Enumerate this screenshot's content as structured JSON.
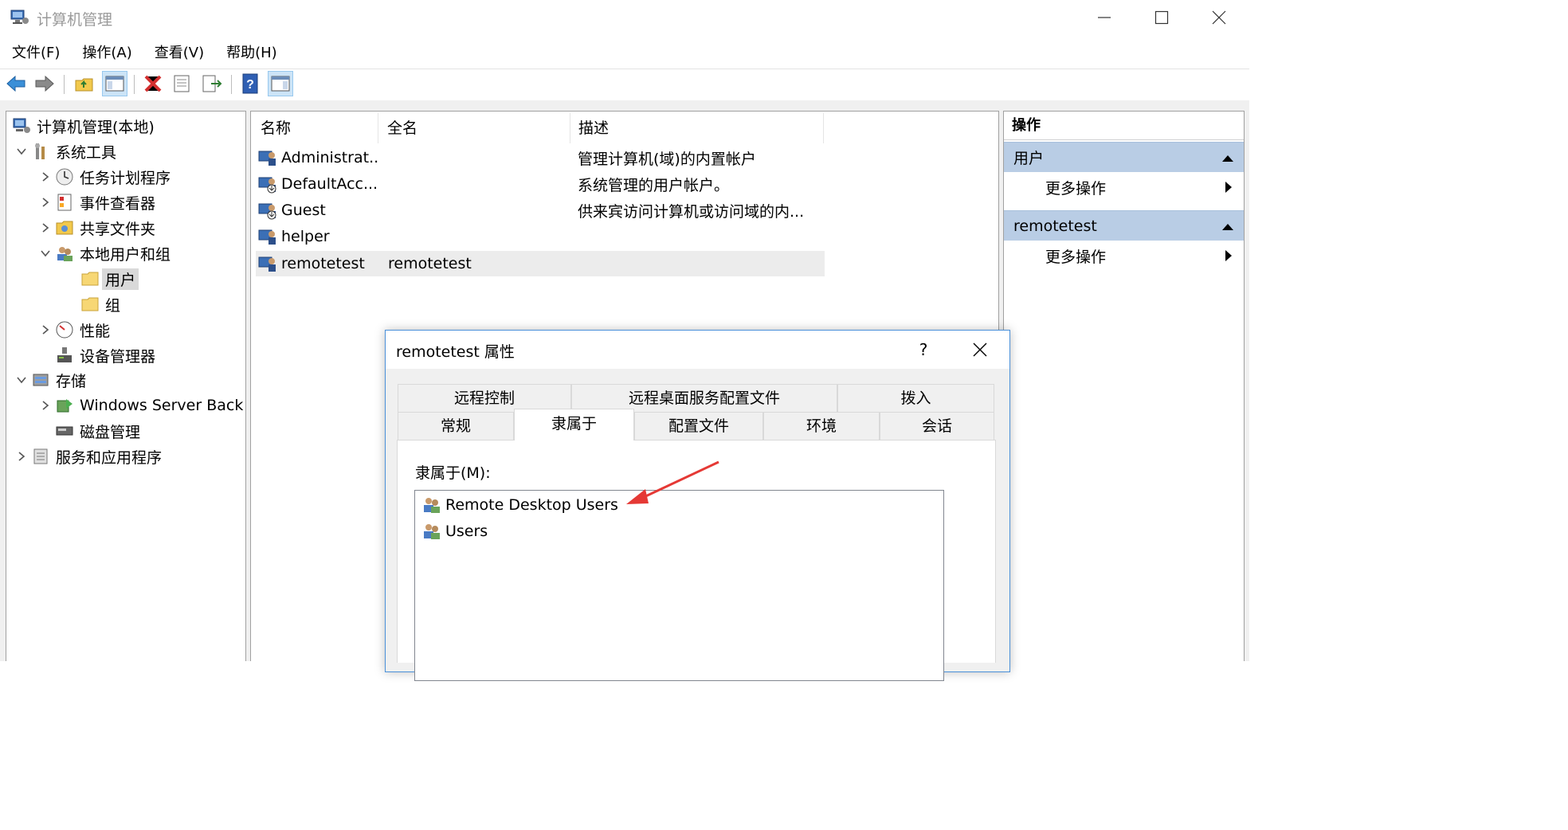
{
  "window": {
    "title": "计算机管理",
    "menu": [
      "文件(F)",
      "操作(A)",
      "查看(V)",
      "帮助(H)"
    ]
  },
  "tree": {
    "root": "计算机管理(本地)",
    "system_tools": "系统工具",
    "task_scheduler": "任务计划程序",
    "event_viewer": "事件查看器",
    "shared_folders": "共享文件夹",
    "local_users": "本地用户和组",
    "users": "用户",
    "groups": "组",
    "performance": "性能",
    "device_manager": "设备管理器",
    "storage": "存储",
    "windows_backup": "Windows Server Back",
    "disk_management": "磁盘管理",
    "services_apps": "服务和应用程序"
  },
  "list": {
    "columns": {
      "name": "名称",
      "fullname": "全名",
      "description": "描述"
    },
    "rows": [
      {
        "name": "Administrat...",
        "fullname": "",
        "description": "管理计算机(域)的内置帐户"
      },
      {
        "name": "DefaultAcc...",
        "fullname": "",
        "description": "系统管理的用户帐户。"
      },
      {
        "name": "Guest",
        "fullname": "",
        "description": "供来宾访问计算机或访问域的内..."
      },
      {
        "name": "helper",
        "fullname": "",
        "description": ""
      },
      {
        "name": "remotetest",
        "fullname": "remotetest",
        "description": ""
      }
    ]
  },
  "actions": {
    "title": "操作",
    "section1": "用户",
    "section1_more": "更多操作",
    "section2": "remotetest",
    "section2_more": "更多操作"
  },
  "dialog": {
    "title": "remotetest 属性",
    "help": "?",
    "tabs_row1": [
      "远程控制",
      "远程桌面服务配置文件",
      "拨入"
    ],
    "tabs_row2": [
      "常规",
      "隶属于",
      "配置文件",
      "环境",
      "会话"
    ],
    "member_of_label": "隶属于(M):",
    "groups": [
      "Remote Desktop Users",
      "Users"
    ]
  },
  "colors": {
    "action_header": "#b9cde5",
    "selection": "#d9d9d9",
    "dialog_border": "#4a90d9",
    "arrow": "#e53935"
  }
}
